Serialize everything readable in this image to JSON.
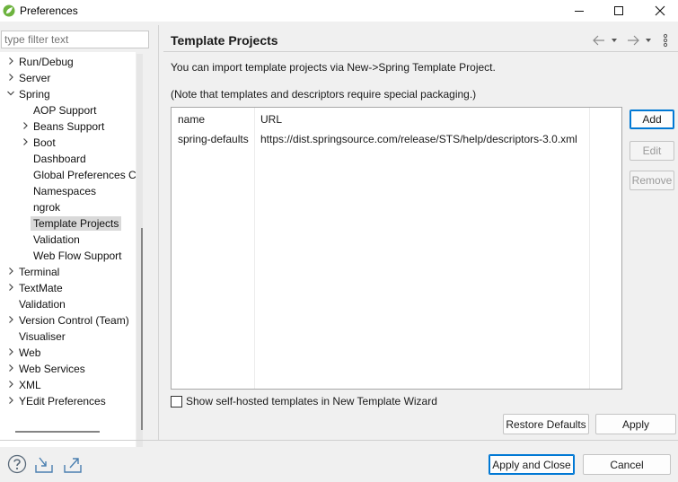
{
  "window": {
    "title": "Preferences"
  },
  "filter": {
    "placeholder": "type filter text"
  },
  "tree": [
    {
      "label": "Run/Debug",
      "arrow": true,
      "level": 0
    },
    {
      "label": "Server",
      "arrow": true,
      "level": 0
    },
    {
      "label": "Spring",
      "arrow": true,
      "expanded": true,
      "level": 0
    },
    {
      "label": "AOP Support",
      "arrow": false,
      "level": 1
    },
    {
      "label": "Beans Support",
      "arrow": true,
      "level": 1
    },
    {
      "label": "Boot",
      "arrow": true,
      "level": 1
    },
    {
      "label": "Dashboard",
      "arrow": false,
      "level": 1
    },
    {
      "label": "Global Preferences C",
      "arrow": false,
      "level": 1
    },
    {
      "label": "Namespaces",
      "arrow": false,
      "level": 1
    },
    {
      "label": "ngrok",
      "arrow": false,
      "level": 1
    },
    {
      "label": "Template Projects",
      "arrow": false,
      "level": 1,
      "selected": true
    },
    {
      "label": "Validation",
      "arrow": false,
      "level": 1
    },
    {
      "label": "Web Flow Support",
      "arrow": false,
      "level": 1
    },
    {
      "label": "Terminal",
      "arrow": true,
      "level": 0
    },
    {
      "label": "TextMate",
      "arrow": true,
      "level": 0
    },
    {
      "label": "Validation",
      "arrow": false,
      "level": 0
    },
    {
      "label": "Version Control (Team)",
      "arrow": true,
      "level": 0
    },
    {
      "label": "Visualiser",
      "arrow": false,
      "level": 0
    },
    {
      "label": "Web",
      "arrow": true,
      "level": 0
    },
    {
      "label": "Web Services",
      "arrow": true,
      "level": 0
    },
    {
      "label": "XML",
      "arrow": true,
      "level": 0
    },
    {
      "label": "YEdit Preferences",
      "arrow": true,
      "level": 0
    }
  ],
  "page": {
    "title": "Template Projects",
    "description": "You can import template projects via New->Spring Template Project.",
    "note": "(Note that templates and descriptors require special packaging.)"
  },
  "table": {
    "headers": [
      "name",
      "URL"
    ],
    "rows": [
      {
        "name": "spring-defaults",
        "url": "https://dist.springsource.com/release/STS/help/descriptors-3.0.xml"
      }
    ]
  },
  "buttons": {
    "add": "Add",
    "edit": "Edit",
    "remove": "Remove",
    "restore_defaults": "Restore Defaults",
    "apply": "Apply",
    "apply_and_close": "Apply and Close",
    "cancel": "Cancel"
  },
  "checkbox": {
    "label": "Show self-hosted templates in New Template Wizard",
    "checked": false
  },
  "icons": {
    "app": "spring-leaf-icon",
    "help": "help-icon",
    "import": "import-icon",
    "export": "export-icon",
    "back": "back-arrow-icon",
    "forward": "forward-arrow-icon",
    "menu": "view-menu-icon"
  },
  "colors": {
    "accent": "#0078d4",
    "spring_green": "#6db33f",
    "selection": "#d9d9d9"
  }
}
